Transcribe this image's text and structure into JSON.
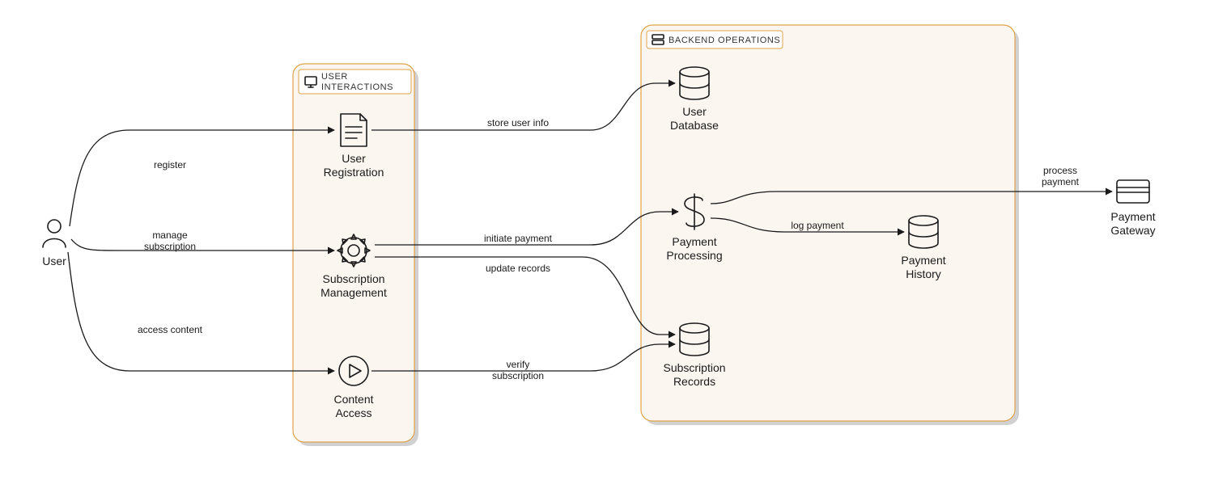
{
  "groups": {
    "user_interactions": {
      "label": "USER INTERACTIONS"
    },
    "backend_operations": {
      "label": "BACKEND OPERATIONS"
    }
  },
  "nodes": {
    "user": {
      "label": "User"
    },
    "user_registration": {
      "label1": "User",
      "label2": "Registration"
    },
    "subscription_management": {
      "label1": "Subscription",
      "label2": "Management"
    },
    "content_access": {
      "label1": "Content",
      "label2": "Access"
    },
    "user_database": {
      "label1": "User",
      "label2": "Database"
    },
    "payment_processing": {
      "label1": "Payment",
      "label2": "Processing"
    },
    "payment_history": {
      "label1": "Payment",
      "label2": "History"
    },
    "subscription_records": {
      "label1": "Subscription",
      "label2": "Records"
    },
    "payment_gateway": {
      "label1": "Payment",
      "label2": "Gateway"
    }
  },
  "edges": {
    "register": {
      "label": "register"
    },
    "manage_subscription": {
      "label1": "manage",
      "label2": "subscription"
    },
    "access_content": {
      "label": "access content"
    },
    "store_user_info": {
      "label": "store user info"
    },
    "initiate_payment": {
      "label": "initiate payment"
    },
    "update_records": {
      "label": "update records"
    },
    "verify_subscription": {
      "label1": "verify",
      "label2": "subscription"
    },
    "process_payment": {
      "label1": "process",
      "label2": "payment"
    },
    "log_payment": {
      "label": "log payment"
    }
  }
}
